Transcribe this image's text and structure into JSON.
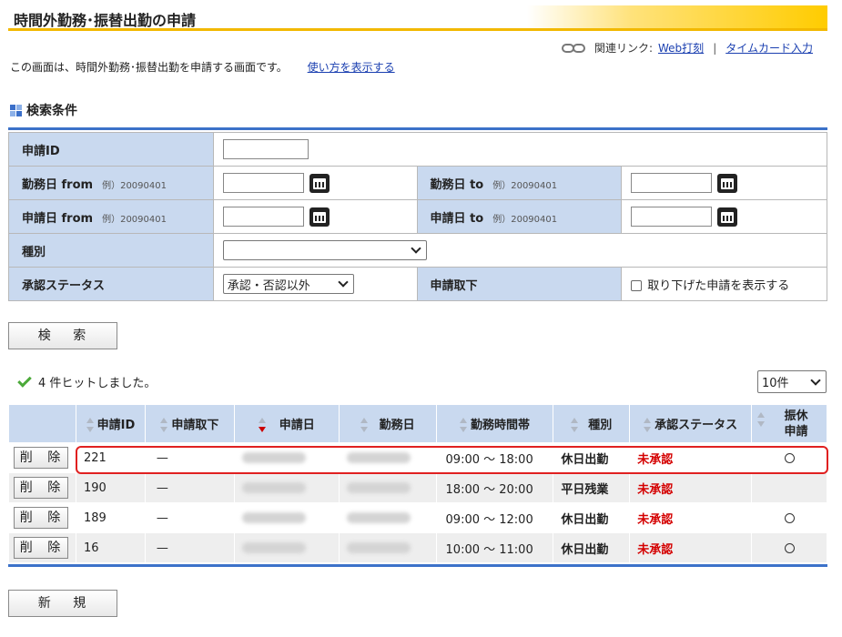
{
  "header": {
    "title": "時間外勤務･振替出勤の申請"
  },
  "related_links": {
    "label": "関連リンク:",
    "links": [
      "Web打刻",
      "タイムカード入力"
    ],
    "separator": "|"
  },
  "description": {
    "text": "この画面は、時間外勤務･振替出勤を申請する画面です。",
    "help_link": "使い方を表示する"
  },
  "search": {
    "section_title": "検索条件",
    "application_id_label": "申請ID",
    "work_date_from_label": "勤務日 from",
    "work_date_to_label": "勤務日 to",
    "apply_date_from_label": "申請日 from",
    "apply_date_to_label": "申請日 to",
    "example": "例）20090401",
    "type_label": "種別",
    "type_value": "",
    "approval_status_label": "承認ステータス",
    "approval_status_value": "承認・否認以外",
    "withdrawal_label": "申請取下",
    "withdrawal_checkbox_label": "取り下げた申請を表示する",
    "search_button": "検 索"
  },
  "results": {
    "hits": "4 件ヒットしました。",
    "per_page": "10件",
    "headers": [
      "",
      "申請ID",
      "申請取下",
      "申請日",
      "勤務日",
      "勤務時間帯",
      "種別",
      "承認ステータス",
      "振休申請"
    ],
    "delete_button": "削 除",
    "rows": [
      {
        "id": "221",
        "withdrawn": "—",
        "time": "09:00 ～ 18:00",
        "type": "休日出勤",
        "status": "未承認",
        "comp": true
      },
      {
        "id": "190",
        "withdrawn": "—",
        "time": "18:00 ～ 20:00",
        "type": "平日残業",
        "status": "未承認",
        "comp": false
      },
      {
        "id": "189",
        "withdrawn": "—",
        "time": "09:00 ～ 12:00",
        "type": "休日出勤",
        "status": "未承認",
        "comp": true
      },
      {
        "id": "16",
        "withdrawn": "—",
        "time": "10:00 ～ 11:00",
        "type": "休日出勤",
        "status": "未承認",
        "comp": true
      }
    ],
    "new_button": "新 規"
  },
  "colors": {
    "accent_blue": "#3c72c9",
    "header_bg": "#c9d9ef",
    "status_red": "#d40000",
    "title_yellow": "#ffcc00"
  }
}
